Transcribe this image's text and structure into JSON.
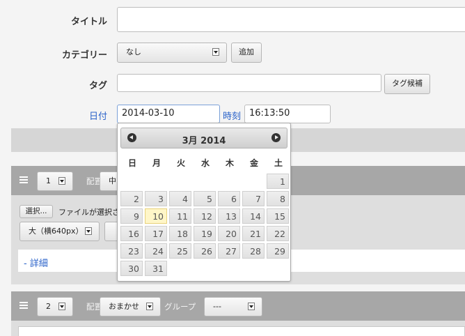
{
  "form": {
    "title_label": "タイトル",
    "title_value": "",
    "category_label": "カテゴリー",
    "category_value": "なし",
    "add_label": "追加",
    "tag_label": "タグ",
    "tag_value": "",
    "tag_suggest_label": "タグ候補",
    "date_label": "日付",
    "date_value": "2014-03-10",
    "time_label": "時刻",
    "time_value": "16:13:50"
  },
  "block1": {
    "order_value": "1",
    "position_label": "配置",
    "position_value": "中",
    "file_button": "選択...",
    "file_status": "ファイルが選択さ",
    "size_value": "大（横640px）",
    "detail_link": "- 詳細"
  },
  "block2": {
    "order_value": "2",
    "position_label": "配置",
    "position_value": "おまかせ",
    "group_label": "グループ",
    "group_value": "---"
  },
  "calendar": {
    "title": "3月 2014",
    "weekdays": [
      "日",
      "月",
      "火",
      "水",
      "木",
      "金",
      "土"
    ],
    "weeks": [
      [
        "",
        "",
        "",
        "",
        "",
        "",
        "1"
      ],
      [
        "2",
        "3",
        "4",
        "5",
        "6",
        "7",
        "8"
      ],
      [
        "9",
        "10",
        "11",
        "12",
        "13",
        "14",
        "15"
      ],
      [
        "16",
        "17",
        "18",
        "19",
        "20",
        "21",
        "22"
      ],
      [
        "23",
        "24",
        "25",
        "26",
        "27",
        "28",
        "29"
      ],
      [
        "30",
        "31",
        "",
        "",
        "",
        "",
        ""
      ]
    ],
    "today": "10"
  },
  "colors": {
    "accent_link": "#2a62c9",
    "today_highlight": "#fff6c8"
  }
}
